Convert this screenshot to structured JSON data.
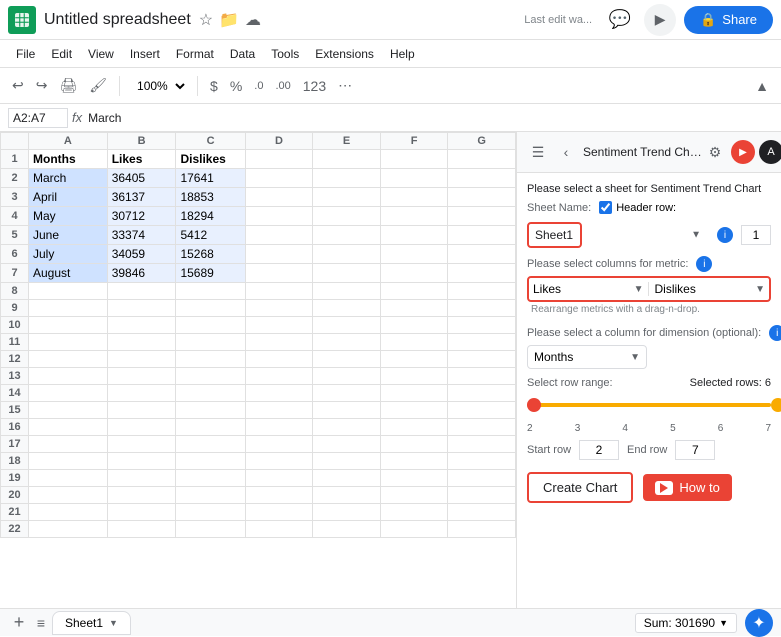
{
  "app": {
    "icon_color": "#0f9d58",
    "title": "Untitled spreadsheet",
    "last_edit": "Last edit wa...",
    "share_label": "Share"
  },
  "menu": {
    "items": [
      "File",
      "Edit",
      "View",
      "Insert",
      "Format",
      "Data",
      "Tools",
      "Extensions",
      "Help"
    ]
  },
  "toolbar": {
    "zoom": "100%",
    "currency_symbol": "$",
    "percent_symbol": "%",
    "decimal_decrease": ".0",
    "decimal_increase": ".00",
    "format_number": "123"
  },
  "formula_bar": {
    "cell_ref": "A2:A7",
    "formula_value": "March"
  },
  "spreadsheet": {
    "col_headers": [
      "",
      "A",
      "B",
      "C",
      "D",
      "E",
      "F",
      "G"
    ],
    "rows": [
      {
        "row_num": "",
        "cells": [
          "Months",
          "Likes",
          "Dislikes",
          "",
          "",
          "",
          ""
        ]
      },
      {
        "row_num": "2",
        "cells": [
          "March",
          "36405",
          "17641",
          "",
          "",
          "",
          ""
        ]
      },
      {
        "row_num": "3",
        "cells": [
          "April",
          "36137",
          "18853",
          "",
          "",
          "",
          ""
        ]
      },
      {
        "row_num": "4",
        "cells": [
          "May",
          "30712",
          "18294",
          "",
          "",
          "",
          ""
        ]
      },
      {
        "row_num": "5",
        "cells": [
          "June",
          "33374",
          "5412",
          "",
          "",
          "",
          ""
        ]
      },
      {
        "row_num": "6",
        "cells": [
          "July",
          "34059",
          "15268",
          "",
          "",
          "",
          ""
        ]
      },
      {
        "row_num": "7",
        "cells": [
          "August",
          "39846",
          "15689",
          "",
          "",
          "",
          ""
        ]
      },
      {
        "row_num": "8",
        "cells": [
          "",
          "",
          "",
          "",
          "",
          "",
          ""
        ]
      },
      {
        "row_num": "9",
        "cells": [
          "",
          "",
          "",
          "",
          "",
          "",
          ""
        ]
      },
      {
        "row_num": "10",
        "cells": [
          "",
          "",
          "",
          "",
          "",
          "",
          ""
        ]
      },
      {
        "row_num": "11",
        "cells": [
          "",
          "",
          "",
          "",
          "",
          "",
          ""
        ]
      },
      {
        "row_num": "12",
        "cells": [
          "",
          "",
          "",
          "",
          "",
          "",
          ""
        ]
      },
      {
        "row_num": "13",
        "cells": [
          "",
          "",
          "",
          "",
          "",
          "",
          ""
        ]
      },
      {
        "row_num": "14",
        "cells": [
          "",
          "",
          "",
          "",
          "",
          "",
          ""
        ]
      },
      {
        "row_num": "15",
        "cells": [
          "",
          "",
          "",
          "",
          "",
          "",
          ""
        ]
      },
      {
        "row_num": "16",
        "cells": [
          "",
          "",
          "",
          "",
          "",
          "",
          ""
        ]
      },
      {
        "row_num": "17",
        "cells": [
          "",
          "",
          "",
          "",
          "",
          "",
          ""
        ]
      },
      {
        "row_num": "18",
        "cells": [
          "",
          "",
          "",
          "",
          "",
          "",
          ""
        ]
      },
      {
        "row_num": "19",
        "cells": [
          "",
          "",
          "",
          "",
          "",
          "",
          ""
        ]
      },
      {
        "row_num": "20",
        "cells": [
          "",
          "",
          "",
          "",
          "",
          "",
          ""
        ]
      },
      {
        "row_num": "21",
        "cells": [
          "",
          "",
          "",
          "",
          "",
          "",
          ""
        ]
      },
      {
        "row_num": "22",
        "cells": [
          "",
          "",
          "",
          "",
          "",
          "",
          ""
        ]
      }
    ]
  },
  "bottom_bar": {
    "add_sheet_label": "+",
    "sheet_name": "Sheet1",
    "sum_label": "Sum: 301690",
    "explore_icon": "✦"
  },
  "panel": {
    "title": "Sentiment Trend Cha...",
    "description": "Please select a sheet for Sentiment Trend Chart",
    "sheet_label": "Sheet Name:",
    "header_row_label": "Header row:",
    "header_row_value": "1",
    "sheet_options": [
      "Sheet1"
    ],
    "selected_sheet": "Sheet1",
    "header_checked": true,
    "metrics_label": "Please select columns for metric:",
    "metric1": "Likes",
    "metric2": "Dislikes",
    "drag_hint": "Rearrange metrics with a drag-n-drop.",
    "dimension_label": "Please select a column for dimension (optional):",
    "dimension_value": "Months",
    "row_range_label": "Select row range:",
    "selected_rows_label": "Selected rows: 6",
    "slider_min": "2",
    "slider_max": "7",
    "slider_ticks": [
      "2",
      "3",
      "4",
      "5",
      "6",
      "7"
    ],
    "start_row_label": "Start row",
    "start_row_value": "2",
    "end_row_label": "End row",
    "end_row_value": "7",
    "create_chart_label": "Create Chart",
    "how_to_label": "How to"
  }
}
